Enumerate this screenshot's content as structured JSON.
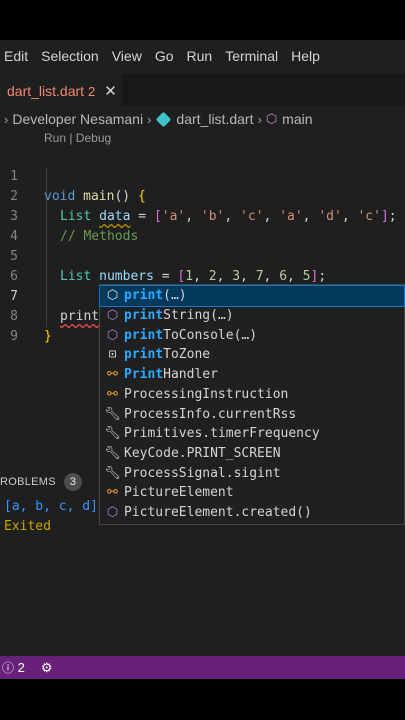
{
  "menu": [
    "Edit",
    "Selection",
    "View",
    "Go",
    "Run",
    "Terminal",
    "Help"
  ],
  "tab": {
    "label": "dart_list.dart",
    "count": "2"
  },
  "breadcrumb": {
    "folder": "Developer Nesamani",
    "file": "dart_list.dart",
    "symbol": "main"
  },
  "codelens": "Run | Debug",
  "line_numbers": [
    "1",
    "2",
    "3",
    "4",
    "5",
    "6",
    "7",
    "8",
    "9"
  ],
  "code": {
    "l1": {
      "kw": "void",
      "fn": "main",
      "rest": "() {"
    },
    "l2": {
      "type": "List",
      "var": "data",
      "eq": " = ",
      "items": [
        "'a'",
        "'b'",
        "'c'",
        "'a'",
        "'d'",
        "'c'"
      ]
    },
    "l3": "// Methods",
    "l5": {
      "type": "List",
      "var": "numbers",
      "eq": " = ",
      "items": [
        "1",
        "2",
        "3",
        "7",
        "6",
        "5"
      ]
    },
    "l7": "print",
    "l8": "}"
  },
  "suggestions": [
    {
      "label": "print(…)",
      "icon": "cube-icon",
      "hl": "print",
      "rest": "(…)"
    },
    {
      "label": "printString(…)",
      "icon": "method-icon",
      "hl": "print",
      "rest": "String(…)"
    },
    {
      "label": "printToConsole(…)",
      "icon": "method-icon",
      "hl": "print",
      "rest": "ToConsole(…)"
    },
    {
      "label": "printToZone",
      "icon": "field-icon",
      "hl": "print",
      "rest": "ToZone"
    },
    {
      "label": "PrintHandler",
      "icon": "class-icon",
      "hl": "Print",
      "rest": "Handler"
    },
    {
      "label": "ProcessingInstruction",
      "icon": "class-icon"
    },
    {
      "label": "ProcessInfo.currentRss",
      "icon": "wrench-icon"
    },
    {
      "label": "Primitives.timerFrequency",
      "icon": "wrench-icon"
    },
    {
      "label": "KeyCode.PRINT_SCREEN",
      "icon": "wrench-icon"
    },
    {
      "label": "ProcessSignal.sigint",
      "icon": "wrench-icon"
    },
    {
      "label": "PictureElement",
      "icon": "class-icon"
    },
    {
      "label": "PictureElement.created()",
      "icon": "method-icon"
    }
  ],
  "panel": {
    "title": "ROBLEMS",
    "badge": "3"
  },
  "output": [
    "[a, b, c, d]",
    "Exited"
  ],
  "status": {
    "errors": "2"
  }
}
